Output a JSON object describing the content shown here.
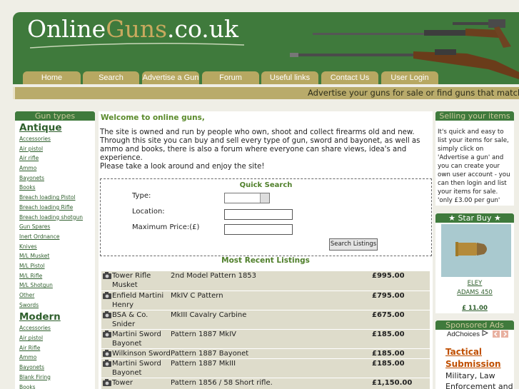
{
  "site": {
    "logo_part1": "Online",
    "logo_part2": "Guns",
    "logo_part3": ".co.uk"
  },
  "nav": {
    "items": [
      "Home",
      "Search",
      "Advertise a Gun",
      "Forum",
      "Useful links",
      "Contact Us",
      "User Login"
    ]
  },
  "ticker": {
    "text": "Advertise your guns for sale or find guns that match your requirements"
  },
  "left_sidebar": {
    "title": "Gun types",
    "antique_heading": "Antique",
    "antique_items": [
      "Accessories",
      "Air pistol",
      "Air rifle",
      "Ammo",
      "Bayonets",
      "Books",
      "Breach loading Pistol",
      "Breach loading Rifle",
      "Breach loading shotgun",
      "Gun Spares",
      "Inert Ordnance",
      "Knives",
      "M/L Musket",
      "M/L Pistol",
      "M/L Rifle",
      "M/L Shotgun",
      "Other",
      "Swords"
    ],
    "modern_heading": "Modern",
    "modern_items": [
      "Accessories",
      "Air pistol",
      "Air Rifle",
      "Ammo",
      "Bayonets",
      "Blank Firing",
      "Books"
    ]
  },
  "welcome": {
    "title": "Welcome to online guns,",
    "line1": "The site is owned and run by people who own, shoot and collect firearms old and new. Through this site you can buy and sell every type of gun, sword and bayonet, as well as ammo and books, there is also a forum where everyone can share views, idea's and experience.",
    "line2": "Please take a look around and enjoy the site!"
  },
  "quick_search": {
    "title": "Quick Search",
    "type_label": "Type:",
    "location_label": "Location:",
    "price_label": "Maximum Price:(£)",
    "type_value": "",
    "location_value": "",
    "price_value": "",
    "button_label": "Search Listings"
  },
  "recent": {
    "title": "Most Recent Listings",
    "rows": [
      {
        "maker": "Tower Rifle Musket",
        "desc": "2nd Model Pattern 1853",
        "price": "£995.00"
      },
      {
        "maker": "Enfield Martini Henry",
        "desc": "MkIV C Pattern",
        "price": "£795.00"
      },
      {
        "maker": "BSA & Co. Snider",
        "desc": "MkIII Cavalry Carbine",
        "price": "£675.00"
      },
      {
        "maker": "Martini Sword Bayonet",
        "desc": "Pattern 1887 MkIV",
        "price": "£185.00"
      },
      {
        "maker": "Wilkinson Sword",
        "desc": "Pattern 1887 Bayonet",
        "price": "£185.00"
      },
      {
        "maker": "Martini Sword Bayonet",
        "desc": "Pattern 1887 MkIII",
        "price": "£185.00"
      },
      {
        "maker": "Tower",
        "desc": "Pattern 1856 / 58 Short rifle.",
        "price": "£1,150.00"
      }
    ]
  },
  "selling": {
    "title": "Selling your items",
    "text": "It's quick and easy to list your items for sale, simply click on 'Advertise a gun' and you can create your own user account - you can then login and list your items for sale. 'only £3.00 per gun'"
  },
  "star_buy": {
    "title": "★ Star Buy ★",
    "name_line1": "ELEY",
    "name_line2": "ADAMS 450",
    "price": "£ 11.00"
  },
  "ads": {
    "title": "Sponsored Ads",
    "adchoices": "AdChoices",
    "ad_title": "Tactical Submission",
    "ad_body": "Military, Law Enforcement and"
  },
  "colors": {
    "header_green": "#3f7a3c",
    "tab_khaki": "#b7a862",
    "ticker_khaki": "#b9ab6b",
    "link_green": "#2f5f2d",
    "heading_green": "#5a8a2a",
    "listing_row": "#dedccb",
    "ad_orange": "#c04f00"
  },
  "icons": [
    "camera-icon",
    "adchoices-icon",
    "ad-prev-icon",
    "ad-next-icon",
    "dropdown-arrow-icon"
  ]
}
